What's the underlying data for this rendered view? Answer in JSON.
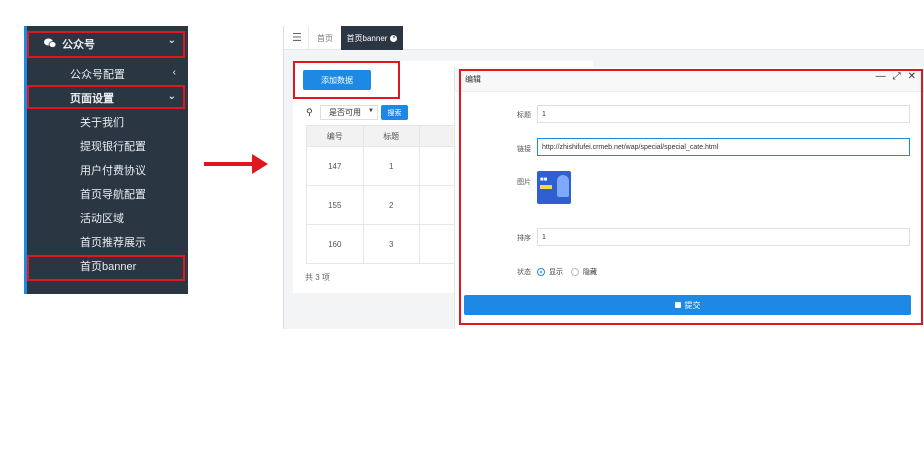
{
  "sidebar": {
    "top_label": "公众号",
    "items": [
      {
        "label": "公众号配置"
      },
      {
        "label": "页面设置"
      },
      {
        "label": "关于我们"
      },
      {
        "label": "提现银行配置"
      },
      {
        "label": "用户付费协议"
      },
      {
        "label": "首页导航配置"
      },
      {
        "label": "活动区域"
      },
      {
        "label": "首页推荐展示"
      },
      {
        "label": "首页banner"
      }
    ]
  },
  "tabs": {
    "home": "首页",
    "active": "首页banner"
  },
  "list": {
    "add_button": "添加数据",
    "filter_value": "是否可用",
    "search_button": "搜索",
    "columns": [
      "编号",
      "标题"
    ],
    "rows": [
      {
        "id": "147",
        "title": "1"
      },
      {
        "id": "155",
        "title": "2"
      },
      {
        "id": "160",
        "title": "3"
      }
    ],
    "total": "共 3 项"
  },
  "modal": {
    "title": "编辑",
    "fields": {
      "title_label": "标题",
      "title_value": "1",
      "link_label": "链接",
      "link_value": "http://zhishifufei.crmeb.net/wap/special/special_cate.html",
      "image_label": "图片",
      "sort_label": "排序",
      "sort_value": "1",
      "status_label": "状态",
      "status_on": "显示",
      "status_off": "隐藏"
    },
    "submit": "提交"
  },
  "colors": {
    "sidebar_bg": "#2b3643",
    "accent": "#1e88e5",
    "highlight": "#e0171f"
  }
}
